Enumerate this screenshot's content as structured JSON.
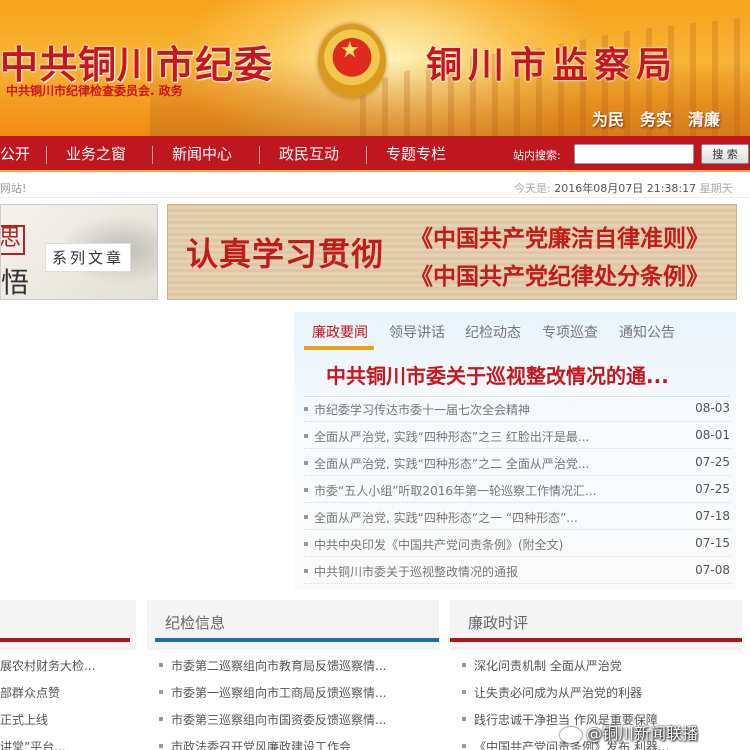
{
  "banner": {
    "title_left": "中共铜川市纪委",
    "subtitle_left": "中共铜川市纪律检查委员会. 政务",
    "title_right": "铜川市监察局",
    "slogans": [
      "为民",
      "务实",
      "清廉"
    ]
  },
  "nav": {
    "items": [
      "公开",
      "业务之窗",
      "新闻中心",
      "政民互动",
      "专题专栏"
    ],
    "search_label": "站内搜索:",
    "search_value": "",
    "search_button": "搜 索"
  },
  "infobar": {
    "welcome": "网站!",
    "date_prefix": "今天是:",
    "date": "2016年08月07日",
    "time": "21:38:17",
    "weekday": "星期天"
  },
  "promos": {
    "left_seal": "思",
    "left_char": "悟",
    "left_label": "系列文章",
    "right_main": "认真学习贯彻",
    "right_line1": "《中国共产党廉洁自律准则》",
    "right_line2": "《中国共产党纪律处分条例》"
  },
  "news": {
    "tabs": [
      "廉政要闻",
      "领导讲话",
      "纪检动态",
      "专项巡查",
      "通知公告"
    ],
    "headline": "中共铜川市委关于巡视整改情况的通...",
    "rows": [
      {
        "title": "市纪委学习传达市委十一届七次全会精神",
        "date": "08-03"
      },
      {
        "title": "全面从严治党, 实践“四种形态”之三 红脸出汗是最...",
        "date": "08-01"
      },
      {
        "title": "全面从严治党, 实践“四种形态”之二 全面从严治党...",
        "date": "07-25"
      },
      {
        "title": "市委“五人小组”听取2016年第一轮巡察工作情况汇...",
        "date": "07-25"
      },
      {
        "title": "全面从严治党, 实践“四种形态”之一 “四种形态”...",
        "date": "07-18"
      },
      {
        "title": "中共中央印发《中国共产党问责条例》(附全文)",
        "date": "07-15"
      },
      {
        "title": "中共铜川市委关于巡视整改情况的通报",
        "date": "07-08"
      }
    ]
  },
  "columns": {
    "col1": {
      "head": "",
      "items": [
        "展农村财务大检...",
        "部群众点赞",
        "正式上线",
        "讲堂”平台..."
      ]
    },
    "col2": {
      "head": "纪检信息",
      "items": [
        "市委第二巡察组向市教育局反馈巡察情...",
        "市委第一巡察组向市工商局反馈巡察情...",
        "市委第三巡察组向市国资委反馈巡察情...",
        "市政法委召开党风廉政建设工作会"
      ]
    },
    "col3": {
      "head": "廉政时评",
      "items": [
        "深化问责机制 全面从严治党",
        "让失责必问成为从严治党的利器",
        "践行忠诚干净担当 作风是重要保障",
        "《中国共产党问责条例》发布 利器..."
      ]
    }
  },
  "watermark": "@铜川新闻联播",
  "colors": {
    "brand_red": "#c0161f",
    "accent_gold": "#e9a21b",
    "blue": "#1e6fa8"
  }
}
